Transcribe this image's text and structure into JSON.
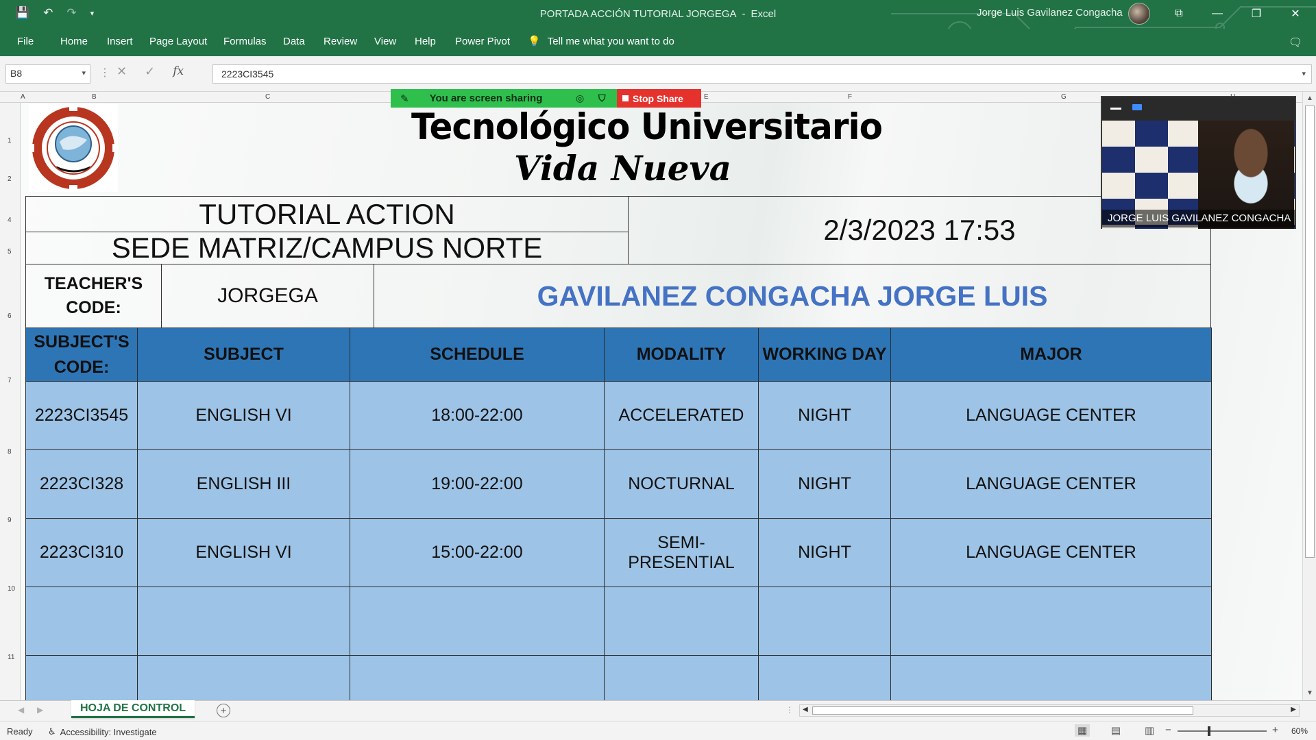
{
  "app": {
    "doc_name": "PORTADA ACCIÓN TUTORIAL JORGEGA",
    "app_name": "Excel",
    "title_separator": "-",
    "user_name": "Jorge Luis Gavilanez Congacha",
    "accent_color": "#217346"
  },
  "ribbon": {
    "tabs": [
      "File",
      "Home",
      "Insert",
      "Page Layout",
      "Formulas",
      "Data",
      "Review",
      "View",
      "Help",
      "Power Pivot"
    ],
    "tell_me": "Tell me what you want to do"
  },
  "formula_bar": {
    "name_box": "B8",
    "fx_label": "fx",
    "value": "2223CI3545"
  },
  "columns": [
    "A",
    "B",
    "C",
    "D",
    "E",
    "F",
    "G",
    "H"
  ],
  "rows": [
    "1",
    "2",
    "4",
    "5",
    "6",
    "7",
    "8",
    "9",
    "10",
    "11"
  ],
  "sheet": {
    "school_line1": "Tecnológico Universitario",
    "school_line2": "Vida Nueva",
    "logo_text": "TECNOLÓGICO UNIVERSITARIO VIDA NUEVA",
    "header_line1": "TUTORIAL ACTION",
    "header_line2": "SEDE MATRIZ/CAMPUS NORTE",
    "datetime": "2/3/2023 17:53",
    "teacher_code_label_1": "TEACHER'S",
    "teacher_code_label_2": "CODE:",
    "teacher_code": "JORGEGA",
    "teacher_name": "GAVILANEZ CONGACHA JORGE LUIS",
    "name_color": "#4472c4",
    "header_fill": "#2e75b6",
    "row_fill": "#9dc3e6"
  },
  "table": {
    "headers": [
      [
        "SUBJECT'S",
        "CODE:"
      ],
      [
        "SUBJECT"
      ],
      [
        "SCHEDULE"
      ],
      [
        "MODALITY"
      ],
      [
        "WORKING DAY"
      ],
      [
        "MAJOR"
      ]
    ],
    "rows": [
      [
        "2223CI3545",
        "ENGLISH VI",
        "18:00-22:00",
        "ACCELERATED",
        "NIGHT",
        "LANGUAGE CENTER"
      ],
      [
        "2223CI328",
        "ENGLISH III",
        "19:00-22:00",
        "NOCTURNAL",
        "NIGHT",
        "LANGUAGE CENTER"
      ],
      [
        "2223CI310",
        "ENGLISH VI",
        "15:00-22:00",
        "SEMI-PRESENTIAL",
        "NIGHT",
        "LANGUAGE CENTER"
      ],
      [
        "",
        "",
        "",
        "",
        "",
        ""
      ],
      [
        "",
        "",
        "",
        "",
        "",
        ""
      ]
    ]
  },
  "screen_share": {
    "status": "You are screen sharing",
    "stop_label": "Stop Share",
    "bar_color": "#2fbf4d",
    "stop_color": "#e5322d"
  },
  "video": {
    "participant_name": "JORGE LUIS GAVILANEZ CONGACHA"
  },
  "sheet_tabs": {
    "active_tab": "HOJA DE CONTROL",
    "add_label": "+"
  },
  "status_bar": {
    "ready": "Ready",
    "accessibility": "Accessibility: Investigate",
    "zoom_minus": "−",
    "zoom_plus": "+",
    "zoom": "60%"
  }
}
